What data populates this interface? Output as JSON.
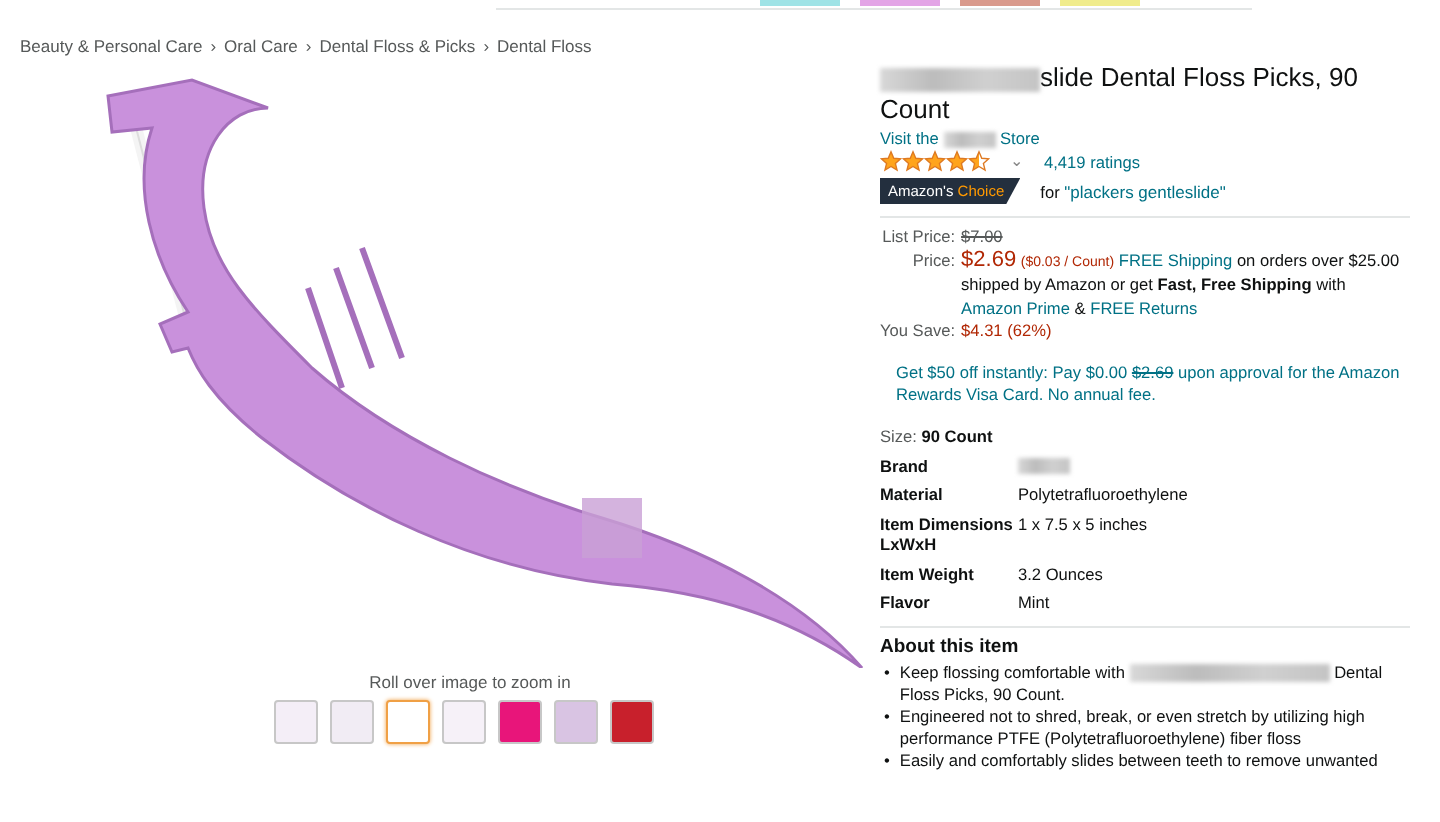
{
  "breadcrumb": [
    "Beauty & Personal Care",
    "Oral Care",
    "Dental Floss & Picks",
    "Dental Floss"
  ],
  "separator": "›",
  "gallery": {
    "hint": "Roll over image to zoom in",
    "thumbnails": [
      {
        "selected": false
      },
      {
        "selected": false
      },
      {
        "selected": true
      },
      {
        "selected": false
      },
      {
        "selected": false
      },
      {
        "selected": false
      },
      {
        "selected": false
      }
    ]
  },
  "product": {
    "title": "slide Dental Floss Picks, 90 Count",
    "store_prefix": "Visit the",
    "store_suffix": "Store",
    "stars": 4.5,
    "caret": "⌄",
    "ratings": "4,419 ratings",
    "badge": {
      "first": "Amazon's",
      "second": "Choice",
      "for": "for",
      "query": "\"plackers gentleslide\""
    }
  },
  "price": {
    "list_label": "List Price:",
    "list_value": "$7.00",
    "price_label": "Price:",
    "price_value": "$2.69",
    "unit": "($0.03 / Count)",
    "shipping_link": "FREE Shipping",
    "shipping_text": "on orders over $25.00 shipped by Amazon or get **Fast, Free Shipping** with",
    "prime_link": "Amazon Prime",
    "amp": "&",
    "returns_link": "FREE Returns",
    "save_label": "You Save:",
    "save_value": "$4.31 (62%)"
  },
  "promo": {
    "before": "Get $50 off instantly: Pay $0.00",
    "struck": "$2.69",
    "after": "upon approval for the Amazon Rewards Visa Card. No annual fee."
  },
  "size": {
    "label": "Size:",
    "value": "90 Count"
  },
  "specs": [
    {
      "name": "Brand"
    },
    {
      "name": "Material",
      "value": "Polytetrafluoroethylene"
    },
    {
      "name": "Item Dimensions LxWxH",
      "value": "1 x 7.5 x 5 inches"
    },
    {
      "name": "Item Weight",
      "value": "3.2 Ounces"
    },
    {
      "name": "Flavor",
      "value": "Mint"
    }
  ],
  "about": {
    "heading": "About this item",
    "marker": "•",
    "bullets": [
      {
        "before": "Keep flossing comfortable with",
        "after": "Dental Floss Picks, 90 Count."
      },
      {
        "before": "Engineered not to shred, break, or even stretch by utilizing high performance PTFE (Polytetrafluoroethylene) fiber floss"
      },
      {
        "before": "Easily and comfortably slides between teeth to remove unwanted"
      }
    ]
  }
}
